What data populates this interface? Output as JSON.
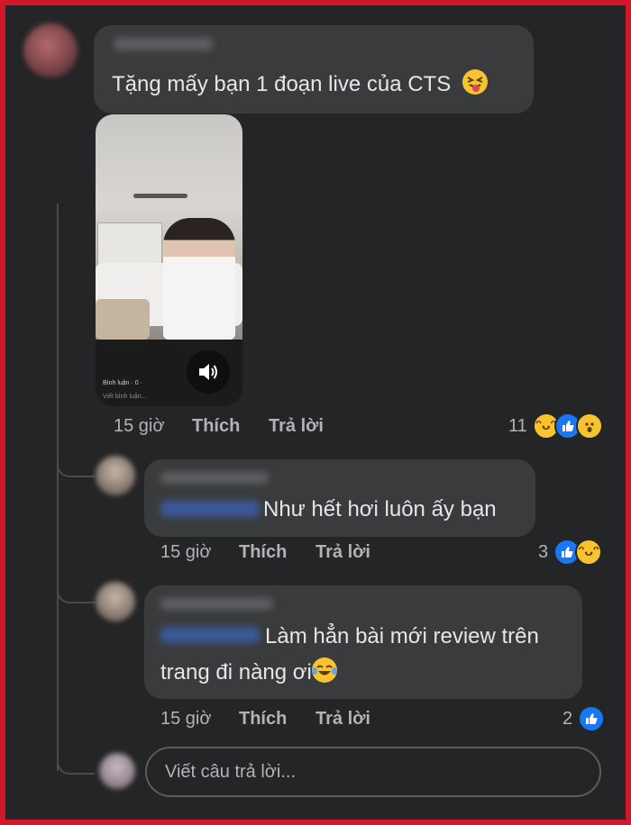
{
  "comments": [
    {
      "text": "Tặng mấy bạn 1 đoạn live của CTS",
      "emoji": "squinting-tongue",
      "time": "15 giờ",
      "like_label": "Thích",
      "reply_label": "Trả lời",
      "reaction_count": "11",
      "reactions": [
        "haha",
        "like",
        "wow"
      ],
      "video": {
        "caption_comments": "Bình luận · 0 · ",
        "caption_write": "Viết bình luận...",
        "sound_icon": "speaker-icon"
      }
    },
    {
      "text": "Như hết hơi luôn ấy bạn",
      "time": "15 giờ",
      "like_label": "Thích",
      "reply_label": "Trả lời",
      "reaction_count": "3",
      "reactions": [
        "like",
        "haha"
      ]
    },
    {
      "text_line1": "Làm hẳn bài mới review trên",
      "text_line2": "trang đi nàng ơi",
      "emoji": "tears-of-joy",
      "time": "15 giờ",
      "like_label": "Thích",
      "reply_label": "Trả lời",
      "reaction_count": "2",
      "reactions": [
        "like"
      ]
    }
  ],
  "reply_input": {
    "placeholder": "Viết câu trả lời..."
  },
  "colors": {
    "background": "#242526",
    "bubble": "#3a3b3c",
    "border": "#d3162a",
    "like": "#1877f2",
    "haha": "#f7c331"
  }
}
